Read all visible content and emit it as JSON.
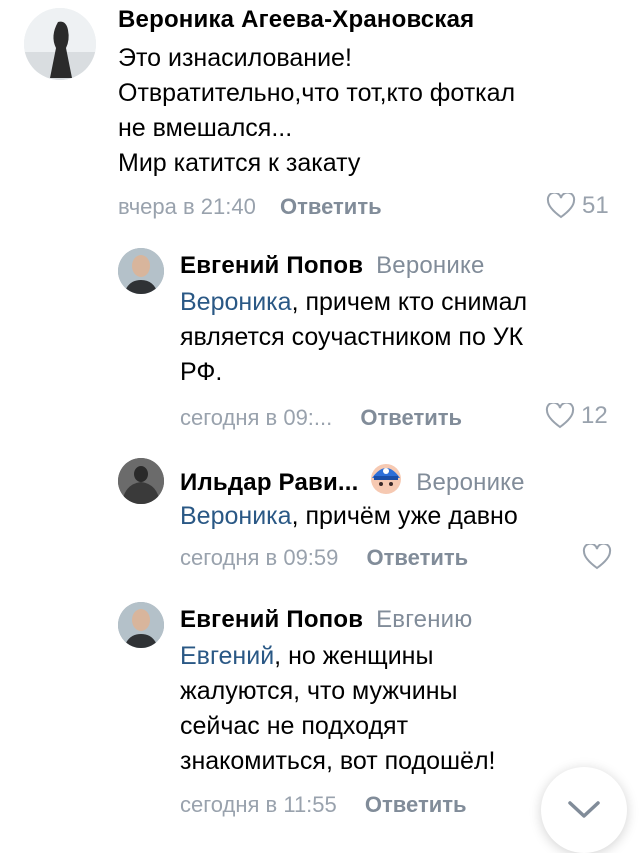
{
  "comments": [
    {
      "author": "Вероника Агеева-Храновская",
      "lines": [
        "Это изнасилование!",
        "Отвратительно,что тот,кто фоткал",
        "не вмешался...",
        "Мир катится к закату"
      ],
      "time": "вчера в 21:40",
      "reply_label": "Ответить",
      "likes": "51"
    },
    {
      "author": "Евгений Попов",
      "addressee": "Веронике",
      "mention": "Вероника",
      "text_after_mention": ", причем кто снимал",
      "lines": [
        "является соучастником по УК",
        "РФ."
      ],
      "time": "сегодня в 09:...",
      "reply_label": "Ответить",
      "likes": "12"
    },
    {
      "author": "Ильдар Рави...",
      "addressee": "Веронике",
      "mention": "Вероника",
      "text_after_mention": ", причём уже давно",
      "time": "сегодня в 09:59",
      "reply_label": "Ответить",
      "likes": ""
    },
    {
      "author": "Евгений Попов",
      "addressee": "Евгению",
      "mention": "Евгений",
      "text_after_mention": ", но женщины",
      "lines": [
        "жалуются, что мужчины",
        "сейчас не подходят",
        "знакомиться, вот подошёл!"
      ],
      "time": "сегодня в 11:55",
      "reply_label": "Ответить"
    }
  ],
  "icons": {
    "like": "heart-outline-icon",
    "scroll": "chevron-down-icon",
    "badge": "emoji-badge-icon"
  },
  "colors": {
    "link": "#2a5885",
    "meta": "#99a2ad",
    "secondary": "#818c99"
  }
}
